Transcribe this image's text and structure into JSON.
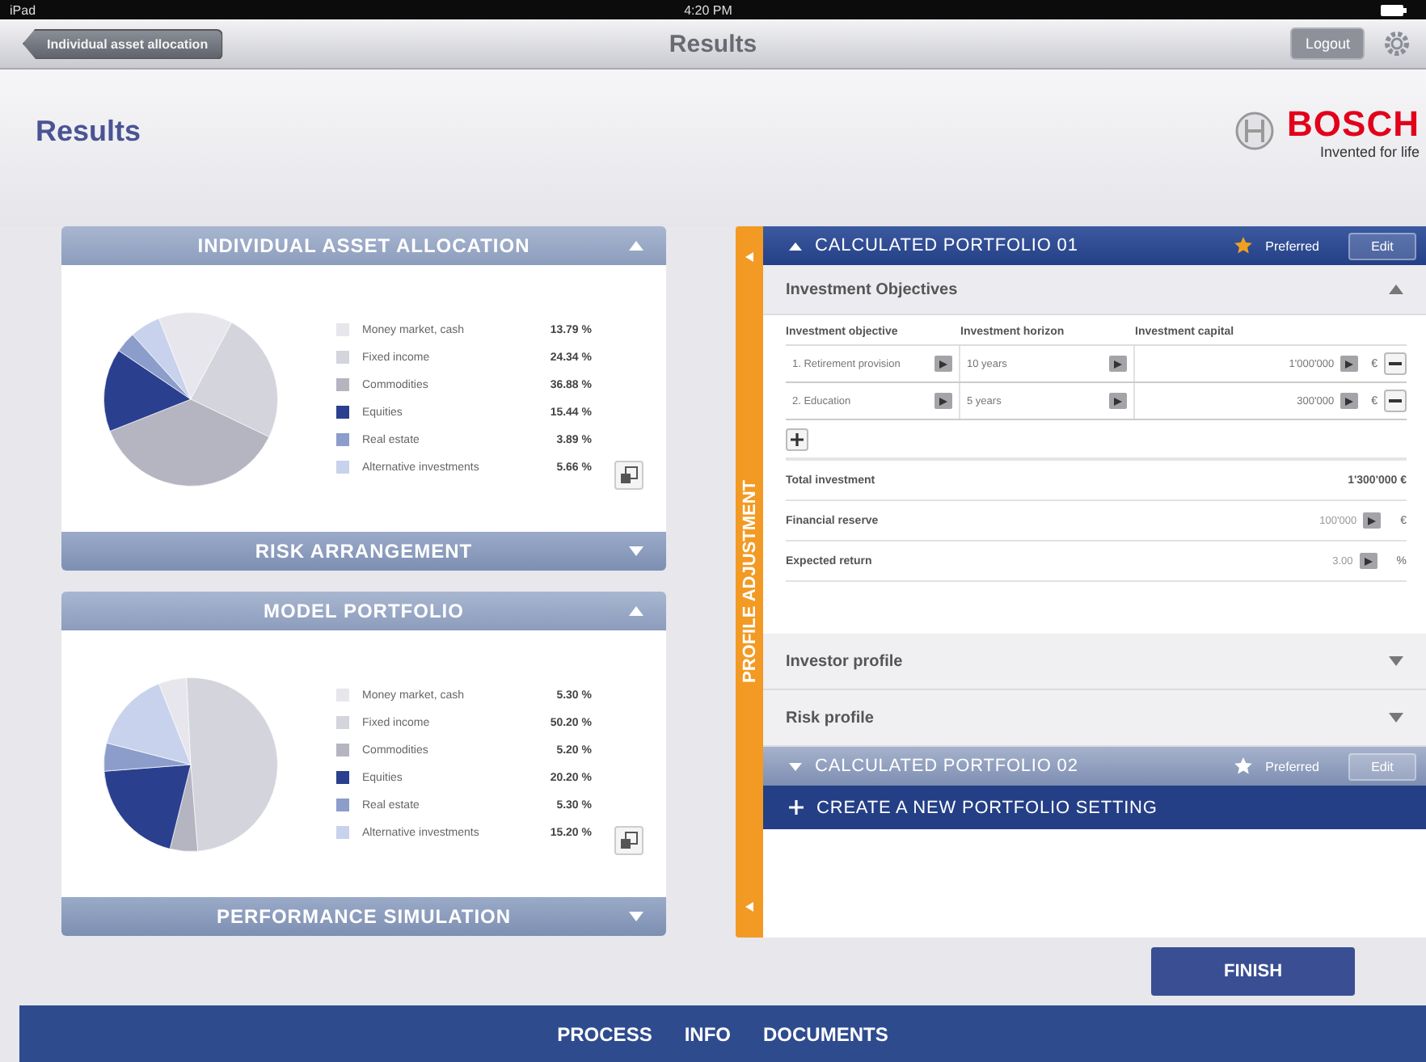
{
  "status_bar": {
    "carrier": "iPad",
    "time": "4:20 PM"
  },
  "nav_bar": {
    "back": "Individual asset allocation",
    "title": "Results",
    "logout": "Logout"
  },
  "page_title": "Results",
  "logo": {
    "brand": "BOSCH",
    "tagline": "Invented for life"
  },
  "left_panels": [
    {
      "title": "INDIVIDUAL ASSET ALLOCATION",
      "expanded": true,
      "chart_data": {
        "type": "pie",
        "categories": [
          "Money market, cash",
          "Fixed income",
          "Commodities",
          "Equities",
          "Real estate",
          "Alternative investments"
        ],
        "values": [
          13.79,
          24.34,
          36.88,
          15.44,
          3.89,
          5.66
        ],
        "colors": [
          "#e6e6ec",
          "#d3d4dc",
          "#b4b5c0",
          "#2b3f8f",
          "#8c9dcb",
          "#c8d2ec"
        ],
        "value_labels": [
          "13.79 %",
          "24.34 %",
          "36.88 %",
          "15.44 %",
          "3.89 %",
          "5.66 %"
        ]
      }
    },
    {
      "title": "RISK ARRANGEMENT",
      "expanded": false
    },
    {
      "title": "MODEL PORTFOLIO",
      "expanded": true,
      "chart_data": {
        "type": "pie",
        "categories": [
          "Money market, cash",
          "Fixed income",
          "Commodities",
          "Equities",
          "Real estate",
          "Alternative investments"
        ],
        "values": [
          5.3,
          50.2,
          5.2,
          20.2,
          5.3,
          15.2
        ],
        "colors": [
          "#e6e6ec",
          "#d3d4dc",
          "#b4b5c0",
          "#2b3f8f",
          "#8c9dcb",
          "#c8d2ec"
        ],
        "value_labels": [
          "5.30 %",
          "50.20 %",
          "5.20 %",
          "20.20 %",
          "5.30 %",
          "15.20 %"
        ]
      }
    },
    {
      "title": "PERFORMANCE SIMULATION",
      "expanded": false
    }
  ],
  "side_tab": {
    "label": "PROFILE ADJUSTMENT"
  },
  "portfolios": [
    {
      "title": "CALCULATED PORTFOLIO 01",
      "expanded": true,
      "preferred": true,
      "preferred_label": "Preferred",
      "edit": "Edit",
      "sections": [
        {
          "title": "Investment Objectives",
          "expanded": true,
          "columns": [
            "Investment objective",
            "Investment horizon",
            "Investment capital"
          ],
          "rows": [
            {
              "objective": "1. Retirement provision",
              "horizon": "10 years",
              "capital": "1'000'000",
              "currency": "€"
            },
            {
              "objective": "2. Education",
              "horizon": "5 years",
              "capital": "300'000",
              "currency": "€"
            }
          ],
          "total": {
            "label": "Total investment",
            "value": "1'300'000 €"
          },
          "reserve": {
            "label": "Financial reserve",
            "placeholder": "100'000",
            "unit": "€"
          },
          "expected_return": {
            "label": "Expected return",
            "placeholder": "3.00",
            "unit": "%"
          }
        },
        {
          "title": "Investor profile",
          "expanded": false
        },
        {
          "title": "Risk profile",
          "expanded": false
        }
      ]
    },
    {
      "title": "CALCULATED PORTFOLIO 02",
      "expanded": false,
      "preferred": false,
      "preferred_label": "Preferred",
      "edit": "Edit"
    }
  ],
  "create_button": "CREATE A NEW PORTFOLIO SETTING",
  "finish_button": "FINISH",
  "bottom_tabs": [
    "PROCESS",
    "INFO",
    "DOCUMENTS"
  ]
}
